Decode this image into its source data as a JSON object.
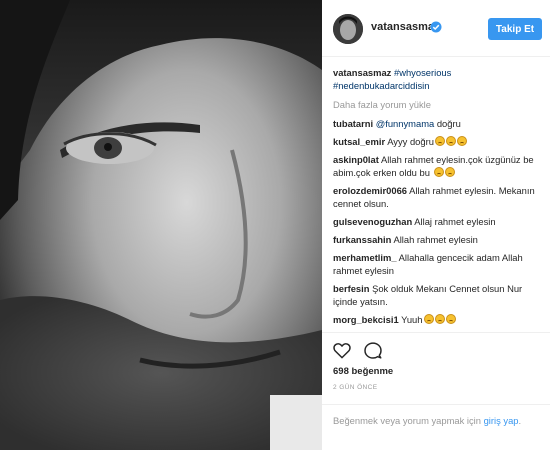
{
  "post": {
    "username": "vatansasmaz",
    "follow_label": "Takip Et",
    "caption_tags": [
      "#whyoserious",
      "#nedenbukadarciddisin"
    ],
    "load_more": "Daha fazla yorum yükle",
    "likes": "698 beğenme",
    "time": "2 GÜN ÖNCE",
    "login_prefix": "Beğenmek veya yorum yapmak için",
    "login_link": "giriş yap",
    "login_suffix": "."
  },
  "comments": [
    {
      "user": "tubatarni",
      "mention": "@funnymama",
      "text": "doğru",
      "emoji": 0
    },
    {
      "user": "kutsal_emir",
      "text": "Ayyy doğru",
      "emoji": 3
    },
    {
      "user": "askinp0lat",
      "text": "Allah rahmet eylesin.çok üzgünüz be abim.çok erken oldu bu",
      "emoji": 2
    },
    {
      "user": "erolozdemir0066",
      "text": "Allah rahmet eylesin. Mekanın cennet olsun.",
      "emoji": 0
    },
    {
      "user": "gulsevenoguzhan",
      "text": "Allaj rahmet eylesin",
      "emoji": 0
    },
    {
      "user": "furkanssahin",
      "text": "Allah rahmet eylesin",
      "emoji": 0
    },
    {
      "user": "merhametlim_",
      "text": "Allahalla gencecik adam Allah rahmet eylesin",
      "emoji": 0
    },
    {
      "user": "berfesin",
      "text": "Şok olduk Mekanı Cennet olsun Nur içinde yatsın.",
      "emoji": 0
    },
    {
      "user": "morg_bekcisi1",
      "text": "Yuuh",
      "emoji": 3
    }
  ],
  "icons": {
    "verified": "verified-badge-icon",
    "like": "heart-icon",
    "comment": "comment-bubble-icon"
  },
  "colors": {
    "accent": "#3897f0",
    "link": "#003569",
    "muted": "#999999"
  }
}
